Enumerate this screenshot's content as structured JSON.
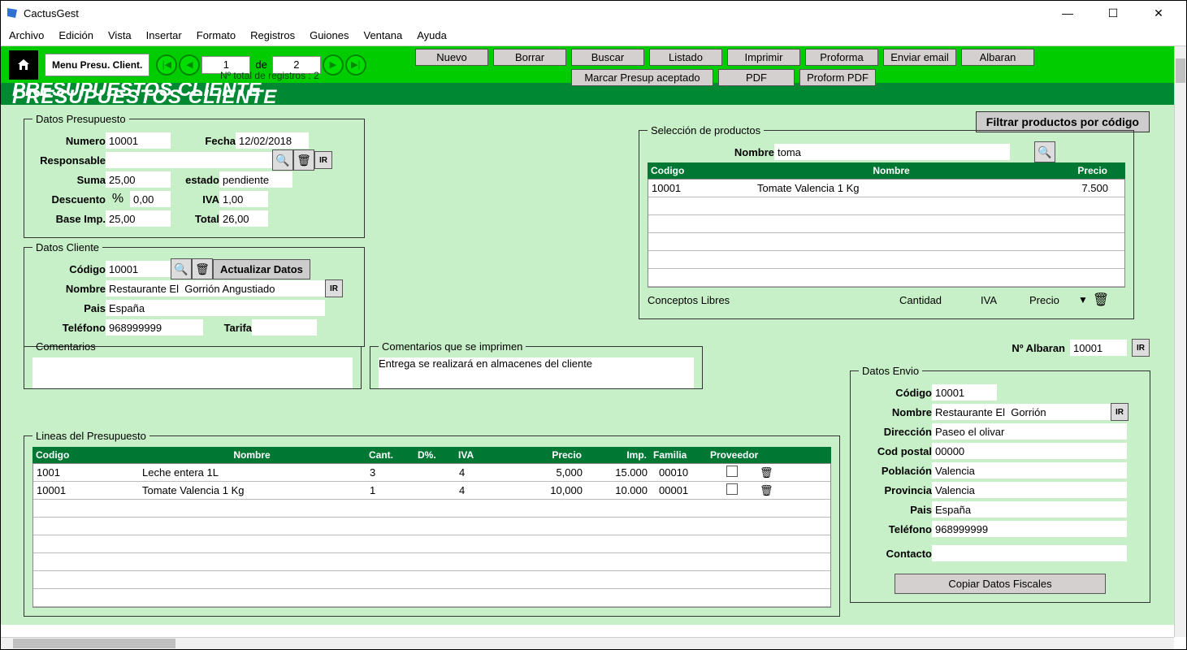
{
  "window": {
    "title": "CactusGest"
  },
  "menubar": [
    "Archivo",
    "Edición",
    "Vista",
    "Insertar",
    "Formato",
    "Registros",
    "Guiones",
    "Ventana",
    "Ayuda"
  ],
  "toolbar": {
    "menu_presu": "Menu Presu. Client.",
    "record_current": "1",
    "record_de": "de",
    "record_total": "2",
    "total_records_label": "Nº total de registros : 2"
  },
  "actions": {
    "nuevo": "Nuevo",
    "borrar": "Borrar",
    "buscar": "Buscar",
    "listado": "Listado",
    "imprimir": "Imprimir",
    "proforma": "Proforma",
    "enviar_email": "Enviar email",
    "albaran": "Albaran",
    "marcar": "Marcar Presup aceptado",
    "pdf": "PDF",
    "proform_pdf": "Proform PDF"
  },
  "header": "PRESUPUESTOS CLIENTE",
  "filter_btn": "Filtrar productos por código",
  "datos_presupuesto": {
    "legend": "Datos Presupuesto",
    "numero_lbl": "Numero",
    "numero": "10001",
    "fecha_lbl": "Fecha",
    "fecha": "12/02/2018",
    "responsable_lbl": "Responsable",
    "responsable": "",
    "suma_lbl": "Suma",
    "suma": "25,00",
    "estado_lbl": "estado",
    "estado": "pendiente",
    "descuento_lbl": "Descuento",
    "descuento_pct": "%",
    "descuento": "0,00",
    "iva_lbl": "IVA",
    "iva": "1,00",
    "base_lbl": "Base Imp.",
    "base": "25,00",
    "total_lbl": "Total",
    "total": "26,00"
  },
  "datos_cliente": {
    "legend": "Datos Cliente",
    "codigo_lbl": "Código",
    "codigo": "10001",
    "actualizar": "Actualizar Datos",
    "nombre_lbl": "Nombre",
    "nombre": "Restaurante El  Gorrión Angustiado",
    "pais_lbl": "Pais",
    "pais": "España",
    "telefono_lbl": "Teléfono",
    "telefono": "968999999",
    "tarifa_lbl": "Tarifa",
    "tarifa": ""
  },
  "comentarios": {
    "legend": "Comentarios",
    "text": ""
  },
  "comentarios_print": {
    "legend": "Comentarios que se imprimen",
    "text": "Entrega se realizará en almacenes del cliente"
  },
  "seleccion": {
    "legend": "Selección de productos",
    "nombre_lbl": "Nombre",
    "nombre": "toma",
    "hdr_codigo": "Codigo",
    "hdr_nombre": "Nombre",
    "hdr_precio": "Precio",
    "rows": [
      {
        "codigo": "10001",
        "nombre": "Tomate Valencia 1 Kg",
        "precio": "7.500"
      }
    ],
    "conceptos_lbl": "Conceptos Libres",
    "cantidad_lbl": "Cantidad",
    "iva_lbl": "IVA",
    "precio_lbl": "Precio"
  },
  "albaran_num": {
    "lbl": "Nº Albaran",
    "val": "10001"
  },
  "lineas": {
    "legend": "Lineas del Presupuesto",
    "hdr": {
      "codigo": "Codigo",
      "nombre": "Nombre",
      "cant": "Cant.",
      "dpct": "D%.",
      "iva": "IVA",
      "precio": "Precio",
      "imp": "Imp.",
      "familia": "Familia",
      "proveedor": "Proveedor"
    },
    "rows": [
      {
        "codigo": "1001",
        "nombre": "Leche entera 1L",
        "cant": "3",
        "dpct": "",
        "iva": "4",
        "precio": "5,000",
        "imp": "15.000",
        "familia": "00010"
      },
      {
        "codigo": "10001",
        "nombre": "Tomate Valencia 1 Kg",
        "cant": "1",
        "dpct": "",
        "iva": "4",
        "precio": "10,000",
        "imp": "10.000",
        "familia": "00001"
      }
    ]
  },
  "datos_envio": {
    "legend": "Datos Envio",
    "codigo_lbl": "Código",
    "codigo": "10001",
    "nombre_lbl": "Nombre",
    "nombre": "Restaurante El  Gorrión",
    "direccion_lbl": "Dirección",
    "direccion": "Paseo el olivar",
    "cp_lbl": "Cod postal",
    "cp": "00000",
    "poblacion_lbl": "Población",
    "poblacion": "Valencia",
    "provincia_lbl": "Provincia",
    "provincia": "Valencia",
    "pais_lbl": "Pais",
    "pais": "España",
    "telefono_lbl": "Teléfono",
    "telefono": "968999999",
    "contacto_lbl": "Contacto",
    "contacto": "",
    "copiar_fiscales": "Copiar Datos Fiscales"
  }
}
